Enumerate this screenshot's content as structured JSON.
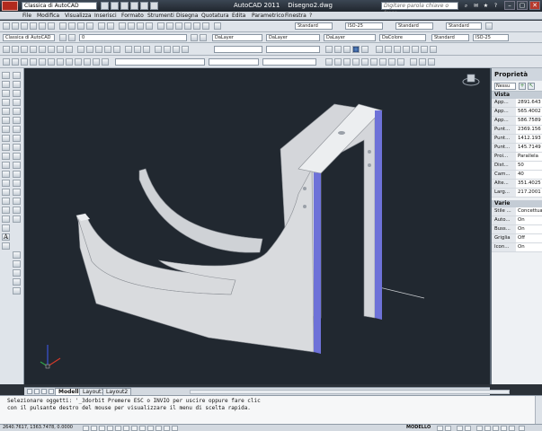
{
  "title_bar": {
    "workspace": "Classica di AutoCAD",
    "app_title": "AutoCAD 2011",
    "document": "Disegno2.dwg",
    "search_placeholder": "Digitare parola chiave o frase"
  },
  "menu": [
    "File",
    "Modifica",
    "Visualizza",
    "Inserisci",
    "Formato",
    "Strumenti",
    "Disegna",
    "Quotatura",
    "Edita",
    "Parametrico",
    "Finestra",
    "?"
  ],
  "toolbars": {
    "text_style": "Standard",
    "dim_style": "ISO-25",
    "table_style": "Standard",
    "layer_color": "DaLayer",
    "layer_linetype": "DaLayer",
    "layer_lineweight": "DaLayer",
    "plot_style": "DaColore",
    "workspace_combo": "Classica di AutoCAD",
    "multileader_style": "Standard",
    "layer_name": "0",
    "table_style2": "Standard",
    "dim_style2": "ISO-25"
  },
  "properties": {
    "title": "Proprietà",
    "selection": "Nessu",
    "section_view": "Vista",
    "view_rows": [
      {
        "key": "App...",
        "value": "2891.643"
      },
      {
        "key": "App...",
        "value": "565.4002"
      },
      {
        "key": "App...",
        "value": "586.7589"
      },
      {
        "key": "Punt...",
        "value": "2369.156"
      },
      {
        "key": "Punt...",
        "value": "1412.193"
      },
      {
        "key": "Punt...",
        "value": "145.7149"
      },
      {
        "key": "Proi...",
        "value": "Parallela"
      },
      {
        "key": "Dist...",
        "value": "50"
      },
      {
        "key": "Cam...",
        "value": "40"
      },
      {
        "key": "Alte...",
        "value": "351.4025"
      },
      {
        "key": "Larg...",
        "value": "217.2001"
      }
    ],
    "section_misc": "Varie",
    "misc_rows": [
      {
        "key": "Stile ...",
        "value": "Concettua"
      },
      {
        "key": "Auto...",
        "value": "On"
      },
      {
        "key": "Buss...",
        "value": "On"
      },
      {
        "key": "Griglia",
        "value": "Off"
      },
      {
        "key": "Icon...",
        "value": "On"
      }
    ]
  },
  "layout_tabs": [
    "Modello",
    "Layout1",
    "Layout2"
  ],
  "command_line": {
    "line1": "Selezionare oggetti: '_3dorbit Premere ESC o INVIO per uscire oppure fare clic",
    "line2": "con il pulsante destro del mouse per visualizzare il menu di scelta rapida."
  },
  "status": {
    "coordinates": "2640.7617, 1363.7478, 0.0000",
    "space": "MODELLO"
  },
  "colors": {
    "viewport_bg": "#212830",
    "model_face": "#d8dadd",
    "model_edge_accent": "#6e72d8"
  }
}
